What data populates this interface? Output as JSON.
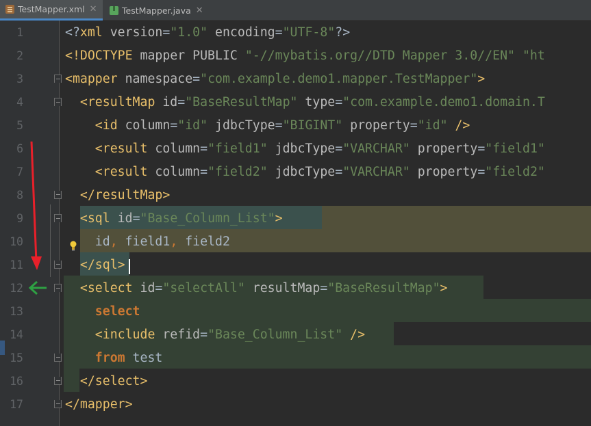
{
  "tabs": [
    {
      "label": "TestMapper.xml",
      "icon": "xml-file-icon",
      "active": true
    },
    {
      "label": "TestMapper.java",
      "icon": "java-interface-icon",
      "active": false
    }
  ],
  "line_numbers": [
    "1",
    "2",
    "3",
    "4",
    "5",
    "6",
    "7",
    "8",
    "9",
    "10",
    "11",
    "12",
    "13",
    "14",
    "15",
    "16",
    "17"
  ],
  "code": {
    "l1": [
      [
        "p",
        "<?"
      ],
      [
        "t",
        "xml "
      ],
      [
        "a",
        "version"
      ],
      [
        "p",
        "="
      ],
      [
        "v",
        "\"1.0\""
      ],
      [
        "a",
        " encoding"
      ],
      [
        "p",
        "="
      ],
      [
        "v",
        "\"UTF-8\""
      ],
      [
        "p",
        "?>"
      ]
    ],
    "l2": [
      [
        "t",
        "<!DOCTYPE "
      ],
      [
        "a",
        "mapper PUBLIC "
      ],
      [
        "v",
        "\"-//mybatis.org//DTD Mapper 3.0//EN\""
      ],
      [
        "v",
        " \"ht"
      ]
    ],
    "l3": [
      [
        "t",
        "<mapper "
      ],
      [
        "a",
        "namespace"
      ],
      [
        "p",
        "="
      ],
      [
        "v",
        "\"com.example.demo1.mapper.TestMapper\""
      ],
      [
        "t",
        ">"
      ]
    ],
    "l4": [
      [
        "t",
        "  <resultMap "
      ],
      [
        "a",
        "id"
      ],
      [
        "p",
        "="
      ],
      [
        "v",
        "\"BaseResultMap\""
      ],
      [
        "a",
        " type"
      ],
      [
        "p",
        "="
      ],
      [
        "v",
        "\"com.example.demo1.domain.T"
      ]
    ],
    "l5": [
      [
        "t",
        "    <id "
      ],
      [
        "a",
        "column"
      ],
      [
        "p",
        "="
      ],
      [
        "v",
        "\"id\""
      ],
      [
        "a",
        " jdbcType"
      ],
      [
        "p",
        "="
      ],
      [
        "v",
        "\"BIGINT\""
      ],
      [
        "a",
        " property"
      ],
      [
        "p",
        "="
      ],
      [
        "v",
        "\"id\""
      ],
      [
        "t",
        " />"
      ]
    ],
    "l6": [
      [
        "t",
        "    <result "
      ],
      [
        "a",
        "column"
      ],
      [
        "p",
        "="
      ],
      [
        "v",
        "\"field1\""
      ],
      [
        "a",
        " jdbcType"
      ],
      [
        "p",
        "="
      ],
      [
        "v",
        "\"VARCHAR\""
      ],
      [
        "a",
        " property"
      ],
      [
        "p",
        "="
      ],
      [
        "v",
        "\"field1\""
      ]
    ],
    "l7": [
      [
        "t",
        "    <result "
      ],
      [
        "a",
        "column"
      ],
      [
        "p",
        "="
      ],
      [
        "v",
        "\"field2\""
      ],
      [
        "a",
        " jdbcType"
      ],
      [
        "p",
        "="
      ],
      [
        "v",
        "\"VARCHAR\""
      ],
      [
        "a",
        " property"
      ],
      [
        "p",
        "="
      ],
      [
        "v",
        "\"field2\""
      ]
    ],
    "l8": [
      [
        "t",
        "  </resultMap>"
      ]
    ],
    "l9": [
      [
        "t",
        "  <sql "
      ],
      [
        "a",
        "id"
      ],
      [
        "p",
        "="
      ],
      [
        "v",
        "\"Base_Column_List\""
      ],
      [
        "t",
        ">"
      ]
    ],
    "l10": [
      [
        "p",
        "    id"
      ],
      [
        "c",
        ","
      ],
      [
        "p",
        " field1"
      ],
      [
        "c",
        ","
      ],
      [
        "p",
        " field2"
      ]
    ],
    "l11": [
      [
        "t",
        "  </sql>"
      ]
    ],
    "l12": [
      [
        "t",
        "  <select "
      ],
      [
        "a",
        "id"
      ],
      [
        "p",
        "="
      ],
      [
        "v",
        "\"selectAll\""
      ],
      [
        "a",
        " resultMap"
      ],
      [
        "p",
        "="
      ],
      [
        "v",
        "\"BaseResultMap\""
      ],
      [
        "t",
        ">"
      ]
    ],
    "l13": [
      [
        "k",
        "    select"
      ]
    ],
    "l14": [
      [
        "t",
        "    <include "
      ],
      [
        "a",
        "refid"
      ],
      [
        "p",
        "="
      ],
      [
        "v",
        "\"Base_Column_List\""
      ],
      [
        "t",
        " />"
      ]
    ],
    "l15": [
      [
        "k",
        "    from"
      ],
      [
        "p",
        " test"
      ]
    ],
    "l16": [
      [
        "t",
        "  </select>"
      ]
    ],
    "l17": [
      [
        "t",
        "</mapper>"
      ]
    ]
  },
  "colors": {
    "background": "#2b2b2b",
    "gutter": "#313335",
    "tag": "#e8bf6a",
    "attribute": "#bababa",
    "string": "#6a8759",
    "keyword": "#cc7832",
    "sql_highlight": "#52503a",
    "select_highlight": "#344134",
    "annotation_red_arrow": "#e8202a",
    "annotation_green_arrow": "#2ea043"
  },
  "annotations": {
    "gutter_icons": [
      "lightbulb-icon",
      "red-down-arrow-icon",
      "green-left-arrow-icon"
    ]
  }
}
